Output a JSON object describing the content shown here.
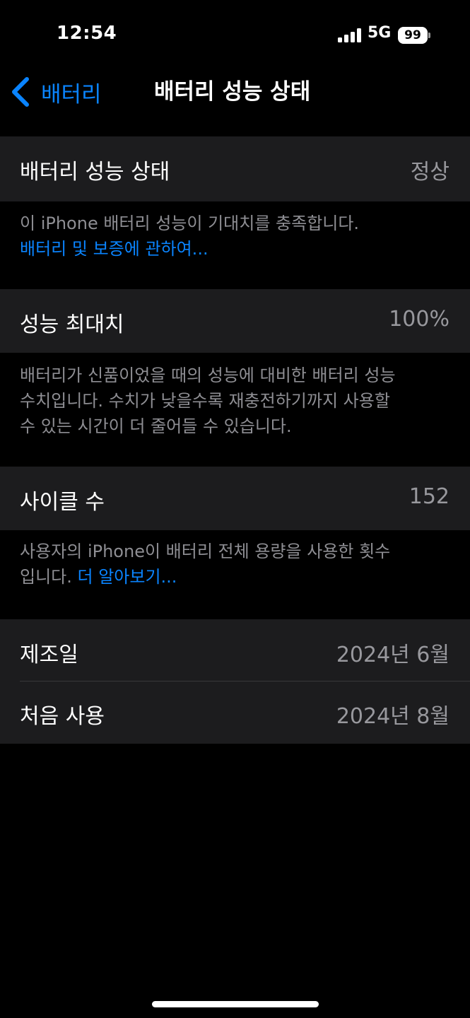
{
  "status_bar": {
    "time": "12:54",
    "network": "5G",
    "battery": "99"
  },
  "nav": {
    "back_label": "배터리",
    "title": "배터리 성능 상태"
  },
  "health": {
    "label": "배터리 성능 상태",
    "value": "정상",
    "footer_text": "이 iPhone 배터리 성능이 기대치를 충족합니다.",
    "footer_link": "배터리 및 보증에 관하여..."
  },
  "max_capacity": {
    "label": "성능 최대치",
    "value": "100%",
    "footer_line1": "배터리가 신품이었을 때의 성능에 대비한 배터리 성능",
    "footer_line2": "수치입니다. 수치가 낮을수록 재충전하기까지 사용할",
    "footer_line3": "수 있는 시간이 더 줄어들 수 있습니다."
  },
  "cycle_count": {
    "label": "사이클 수",
    "value": "152",
    "footer_line1": "사용자의 iPhone이 배터리 전체 용량을 사용한 횟수",
    "footer_line2_prefix": "입니다.",
    "footer_link": "더 알아보기..."
  },
  "dates": {
    "manufacture_label": "제조일",
    "manufacture_value": "2024년 6월",
    "first_use_label": "처음 사용",
    "first_use_value": "2024년 8월"
  },
  "colors": {
    "background": "#000000",
    "cell": "#1c1c1e",
    "accent": "#0a84ff",
    "secondary_text": "#8e8e93"
  }
}
